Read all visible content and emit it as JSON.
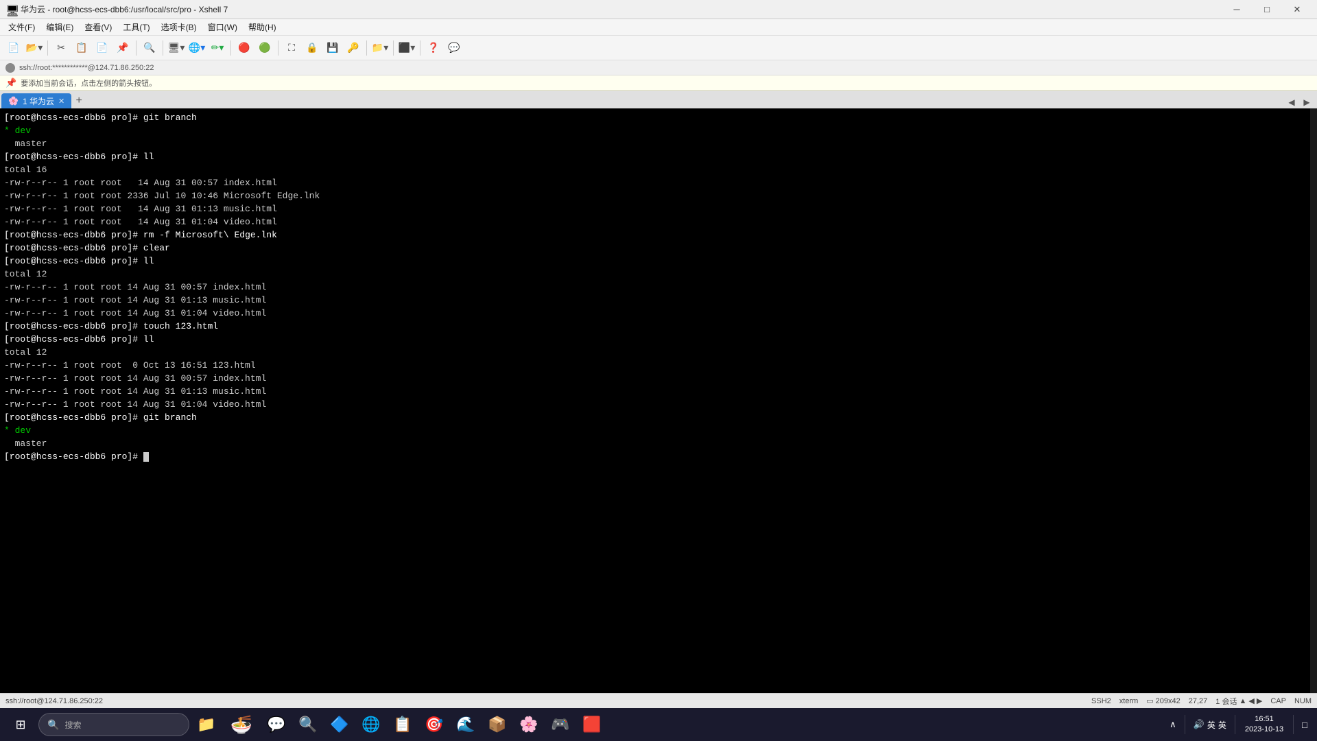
{
  "titleBar": {
    "title": "华为云 - root@hcss-ecs-dbb6:/usr/local/src/pro - Xshell 7",
    "icon": "⬛",
    "minBtn": "─",
    "maxBtn": "□",
    "closeBtn": "✕"
  },
  "menuBar": {
    "items": [
      "文件(F)",
      "编辑(E)",
      "查看(V)",
      "工具(T)",
      "选项卡(B)",
      "窗口(W)",
      "帮助(H)"
    ]
  },
  "toolbar": {
    "groups": [
      [
        "📄",
        "📁▾"
      ],
      [
        "✂",
        "📋",
        "📄",
        "📌"
      ],
      [
        "🔍"
      ],
      [
        "🖥▾",
        "🌐▾",
        "🖊▾"
      ],
      [
        "🔴",
        "🟢"
      ],
      [
        "⬛",
        "⬜"
      ],
      [
        "🔒",
        "💾",
        "🔑"
      ],
      [
        "📁▾"
      ],
      [
        "⬛▾"
      ],
      [
        "❓"
      ],
      [
        "💬"
      ]
    ]
  },
  "sshBar": {
    "text": "ssh://root:************@124.71.86.250:22"
  },
  "noticeBar": {
    "text": "要添加当前会话，点击左侧的箭头按钮。"
  },
  "tabs": [
    {
      "label": "1 华为云",
      "active": true
    }
  ],
  "terminal": {
    "lines": [
      "[root@hcss-ecs-dbb6 pro]# git branch",
      "* dev",
      "  master",
      "[root@hcss-ecs-dbb6 pro]# ll",
      "total 16",
      "-rw-r--r-- 1 root root   14 Aug 31 00:57 index.html",
      "-rw-r--r-- 1 root root 2336 Jul 10 10:46 Microsoft Edge.lnk",
      "-rw-r--r-- 1 root root   14 Aug 31 01:13 music.html",
      "-rw-r--r-- 1 root root   14 Aug 31 01:04 video.html",
      "[root@hcss-ecs-dbb6 pro]# rm -f Microsoft\\ Edge.lnk",
      "[root@hcss-ecs-dbb6 pro]# clear",
      "[root@hcss-ecs-dbb6 pro]# ll",
      "total 12",
      "-rw-r--r-- 1 root root 14 Aug 31 00:57 index.html",
      "-rw-r--r-- 1 root root 14 Aug 31 01:13 music.html",
      "-rw-r--r-- 1 root root 14 Aug 31 01:04 video.html",
      "[root@hcss-ecs-dbb6 pro]# touch 123.html",
      "[root@hcss-ecs-dbb6 pro]# ll",
      "total 12",
      "-rw-r--r-- 1 root root  0 Oct 13 16:51 123.html",
      "-rw-r--r-- 1 root root 14 Aug 31 00:57 index.html",
      "-rw-r--r-- 1 root root 14 Aug 31 01:13 music.html",
      "-rw-r--r-- 1 root root 14 Aug 31 01:04 video.html",
      "[root@hcss-ecs-dbb6 pro]# git branch",
      "* dev",
      "  master",
      "[root@hcss-ecs-dbb6 pro]# "
    ]
  },
  "statusBar": {
    "left": "ssh://root@124.71.86.250:22",
    "ssh": "SSH2",
    "term": "xterm",
    "cols": "209x42",
    "cursor": "27,27",
    "session": "1 会话",
    "cap": "CAP",
    "num": "NUM"
  },
  "taskbar": {
    "startIcon": "⊞",
    "searchPlaceholder": "搜索",
    "icons": [
      {
        "name": "file-explorer",
        "emoji": "📁",
        "active": false
      },
      {
        "name": "wechat",
        "emoji": "💬",
        "active": false
      },
      {
        "name": "search-app",
        "emoji": "🔍",
        "active": false
      },
      {
        "name": "unknown1",
        "emoji": "🔷",
        "active": false
      },
      {
        "name": "chrome",
        "emoji": "🌐",
        "active": false
      },
      {
        "name": "unknown2",
        "emoji": "📋",
        "active": false
      },
      {
        "name": "unknown3",
        "emoji": "🎯",
        "active": false
      },
      {
        "name": "edge",
        "emoji": "🌊",
        "active": false
      },
      {
        "name": "unknown4",
        "emoji": "📦",
        "active": false
      },
      {
        "name": "flower",
        "emoji": "🌸",
        "active": false
      },
      {
        "name": "unknown5",
        "emoji": "🎮",
        "active": false
      },
      {
        "name": "unknown6",
        "emoji": "🟥",
        "active": false
      }
    ],
    "sysTray": {
      "upArrow": "∧",
      "network": "英",
      "input": "英",
      "keyboard": "⌨"
    },
    "clock": {
      "time": "16:51",
      "date": "2023-10-13"
    },
    "notificationBtn": "🔔"
  }
}
